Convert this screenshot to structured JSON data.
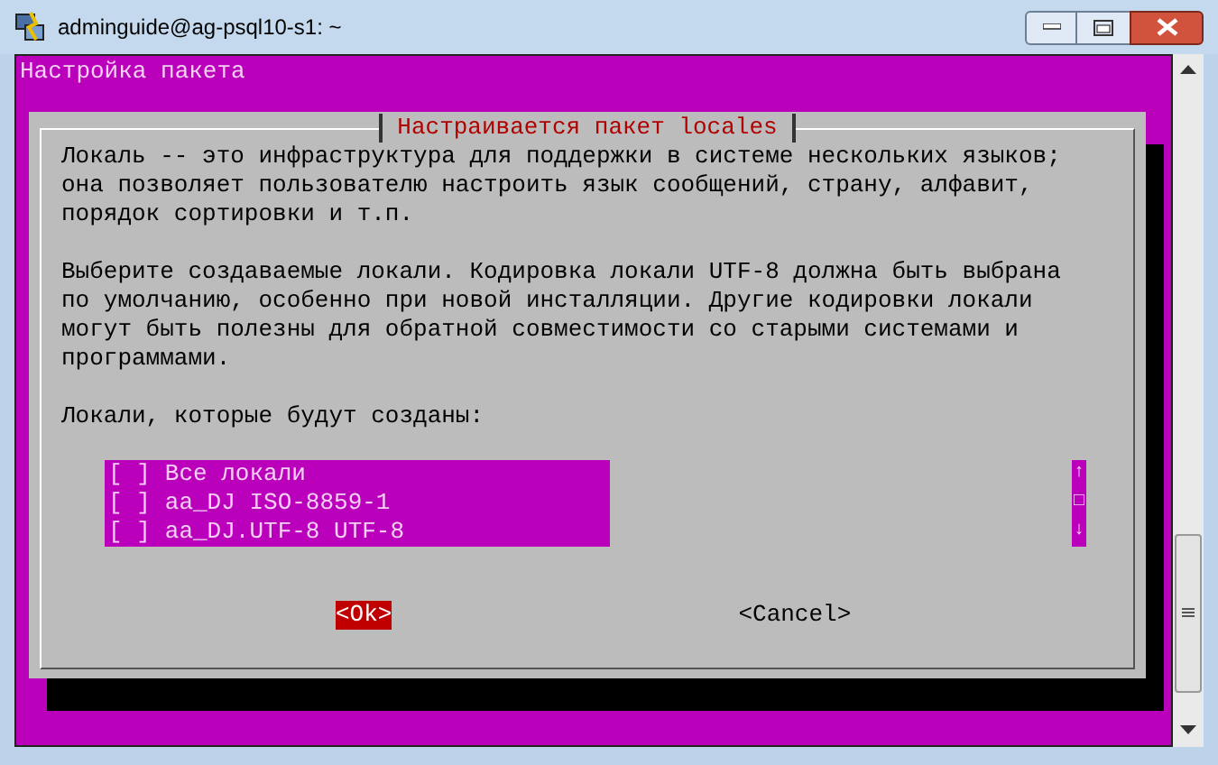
{
  "window": {
    "title": "adminguide@ag-psql10-s1: ~"
  },
  "terminal": {
    "header": "Настройка пакета"
  },
  "dialog": {
    "title": "Настраивается пакет locales",
    "paragraphs": [
      "Локаль -- это инфраструктура для поддержки в системе нескольких языков;\nона позволяет пользователю настроить язык сообщений, страну, алфавит,\nпорядок сортировки и т.п.",
      "Выберите создаваемые локали. Кодировка локали UTF-8 должна быть выбрана\nпо умолчанию, особенно при новой инсталляции. Другие кодировки локали\nмогут быть полезны для обратной совместимости со старыми системами и\nпрограммами.",
      "Локали, которые будут созданы:"
    ],
    "items": [
      {
        "box": "[ ]",
        "label": "Все локали",
        "checked": false
      },
      {
        "box": "[ ]",
        "label": "aa_DJ ISO-8859-1",
        "checked": false
      },
      {
        "box": "[ ]",
        "label": "aa_DJ.UTF-8 UTF-8",
        "checked": false
      }
    ],
    "scroll_marks": [
      "↑",
      "□",
      "↓"
    ],
    "buttons": [
      {
        "label": "<Ok>",
        "selected": true
      },
      {
        "label": "<Cancel>",
        "selected": false
      }
    ]
  }
}
